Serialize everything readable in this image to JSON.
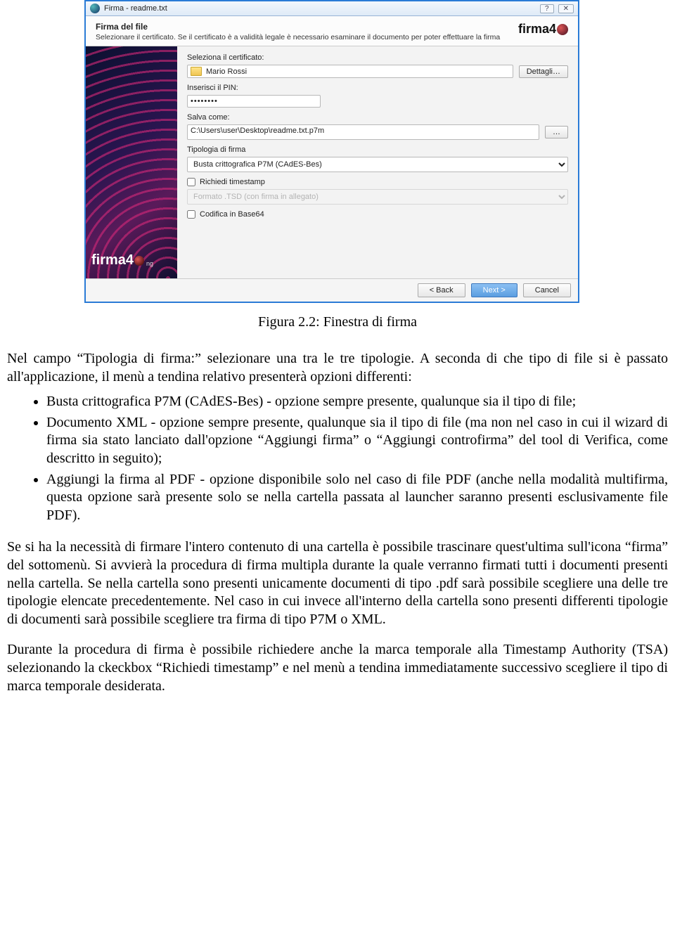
{
  "window": {
    "title": "Firma - readme.txt",
    "help_btn": "?",
    "close_btn": "✕",
    "header_title": "Firma del file",
    "header_sub": "Selezionare il certificato. Se il certificato è a validità legale è necessario esaminare il documento per poter effettuare la firma",
    "logo_text": "firma4",
    "side_logo_text": "firma4",
    "side_logo_suffix": "ng",
    "labels": {
      "seleziona_cert": "Seleziona il certificato:",
      "cert_value": "Mario Rossi",
      "dettagli": "Dettagli…",
      "inserisci_pin": "Inserisci il PIN:",
      "pin_value": "••••••••",
      "salva_come": "Salva come:",
      "path_value": "C:\\Users\\user\\Desktop\\readme.txt.p7m",
      "browse": "…",
      "tipologia": "Tipologia di firma",
      "tipologia_value": "Busta crittografica P7M (CAdES-Bes)",
      "richiedi_ts": "Richiedi timestamp",
      "formato_tsd": "Formato .TSD (con firma in allegato)",
      "codifica_b64": "Codifica in Base64"
    },
    "footer": {
      "back": "< Back",
      "next": "Next >",
      "cancel": "Cancel"
    }
  },
  "doc": {
    "caption": "Figura 2.2: Finestra di firma",
    "p_intro": "Nel campo “Tipologia di firma:” selezionare una tra le tre tipologie. A seconda di che tipo di file si è passato all'applicazione, il menù a tendina relativo presenterà opzioni differenti:",
    "bullet1": "Busta crittografica P7M (CAdES-Bes) - opzione sempre presente, qualunque sia il tipo di file;",
    "bullet2": "Documento XML - opzione sempre presente, qualunque sia il tipo di file (ma non nel caso in cui il wizard di firma sia stato lanciato dall'opzione “Aggiungi firma” o “Aggiungi controfirma” del tool di Verifica, come descritto in seguito);",
    "bullet3": "Aggiungi la firma al PDF - opzione disponibile solo nel caso di file PDF (anche nella modalità multifirma, questa opzione sarà presente solo se nella cartella passata al launcher saranno presenti esclusivamente file PDF).",
    "p_folder": "Se si ha la necessità di firmare l'intero contenuto di una cartella è possibile trascinare quest'ultima sull'icona “firma” del sottomenù. Si avvierà la procedura di firma multipla durante la quale verranno firmati tutti  i documenti presenti nella cartella. Se nella cartella sono presenti unicamente documenti di tipo .pdf sarà possibile scegliere una delle tre tipologie elencate precedentemente. Nel caso in cui invece all'interno della cartella sono presenti differenti tipologie di documenti sarà possibile scegliere tra firma di tipo P7M o XML.",
    "p_ts": "Durante la procedura di firma è possibile richiedere anche la marca temporale alla Timestamp Authority (TSA) selezionando la ckeckbox “Richiedi timestamp” e nel menù a tendina immediatamente successivo scegliere il tipo di marca temporale desiderata."
  }
}
